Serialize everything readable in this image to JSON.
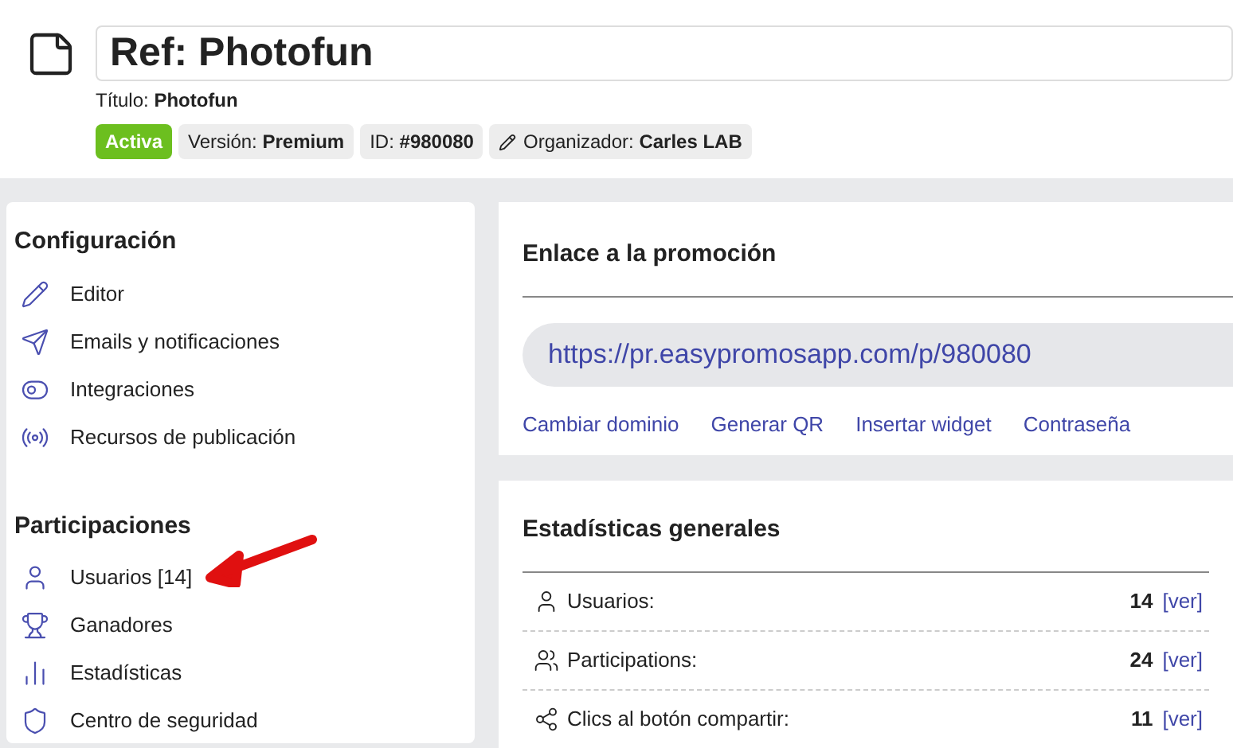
{
  "header": {
    "title": "Ref: Photofun",
    "subtitle": "Título: **Photofun**",
    "badges": [
      {
        "kind": "status",
        "text": "Activa"
      },
      {
        "kind": "info",
        "text": "Versión: **Premium**"
      },
      {
        "kind": "info",
        "text": "ID: **#980080**"
      },
      {
        "kind": "organizer",
        "text": "Organizador: **Carles LAB**"
      }
    ]
  },
  "sidebar": {
    "sections": [
      {
        "title": "Configuración",
        "items": [
          "Editor",
          "Emails y notificaciones",
          "Integraciones",
          "Recursos de publicación"
        ]
      },
      {
        "title": "Participaciones",
        "items": [
          "Usuarios [14]",
          "Ganadores",
          "Estadísticas",
          "Centro de seguridad"
        ]
      }
    ]
  },
  "link_card": {
    "title": "Enlace a la promoción",
    "url": "https://pr.easypromosapp.com/p/980080",
    "actions": [
      "Cambiar dominio",
      "Generar QR",
      "Insertar widget",
      "Contraseña"
    ]
  },
  "stats_card": {
    "title": "Estadísticas generales",
    "rows": [
      {
        "label": "Usuarios:",
        "value": "14",
        "link": "[ver]"
      },
      {
        "label": "Participations:",
        "value": "24",
        "link": "[ver]"
      },
      {
        "label": "Clics al botón compartir:",
        "value": "11",
        "link": "[ver]"
      }
    ]
  }
}
